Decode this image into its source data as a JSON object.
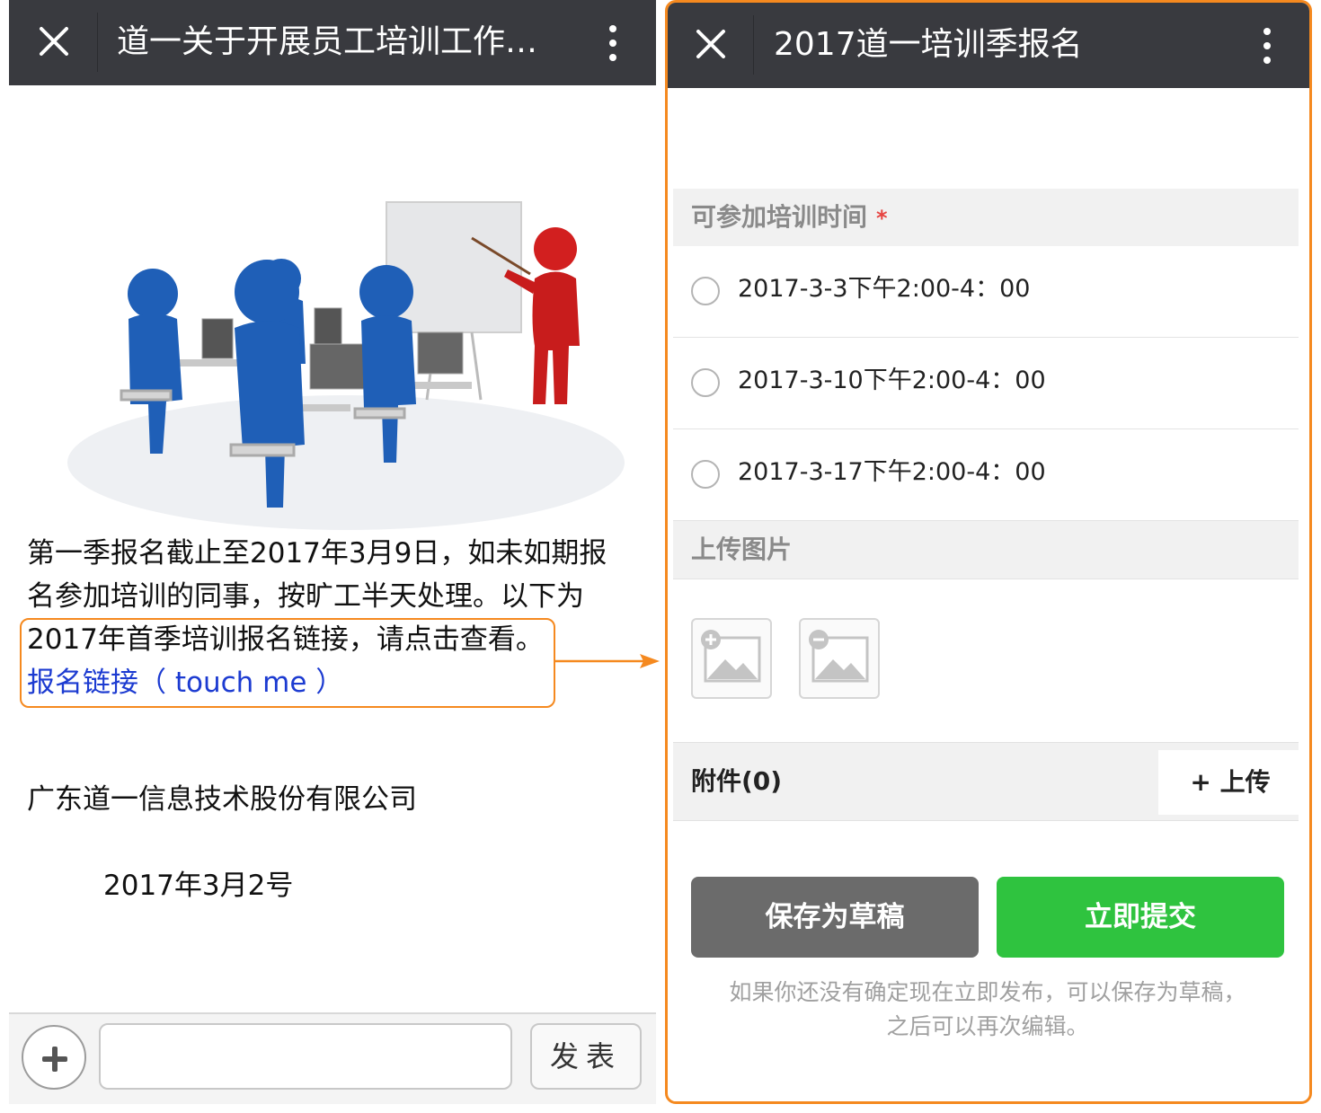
{
  "left_screen": {
    "header": {
      "title": "道一关于开展员工培训工作通...",
      "close_icon": "close-icon",
      "more_icon": "more-vertical-icon"
    },
    "article": {
      "line1": "第一季报名截止至2017年3月9日，如未如期报",
      "line2": "名参加培训的同事，按旷工半天处理。以下为",
      "line3": "2017年首季培训报名链接，请点击查看。",
      "link_text": "报名链接（ touch me ）",
      "company": "广东道一信息技术股份有限公司",
      "date": "2017年3月2号"
    },
    "comment_bar": {
      "plus_icon": "plus-icon",
      "input_value": "",
      "send_label": "发表"
    }
  },
  "right_screen": {
    "header": {
      "title": "2017道一培训季报名",
      "close_icon": "close-icon",
      "more_icon": "more-vertical-icon"
    },
    "training_time": {
      "label": "可参加培训时间",
      "required_mark": "*",
      "options": [
        "2017-3-3下午2:00-4：00",
        "2017-3-10下午2:00-4：00",
        "2017-3-17下午2:00-4：00"
      ]
    },
    "upload_images": {
      "label": "上传图片",
      "add_icon": "add-image-icon",
      "remove_icon": "remove-image-icon"
    },
    "attachment": {
      "label": "附件(0)",
      "upload_label": "+ 上传"
    },
    "buttons": {
      "draft": "保存为草稿",
      "submit": "立即提交"
    },
    "hint_line1": "如果你还没有确定现在立即发布，可以保存为草稿，",
    "hint_line2": "之后可以再次编辑。"
  },
  "colors": {
    "header_bg": "#393a3f",
    "highlight_orange": "#f5891f",
    "link_blue": "#1c3bd1",
    "submit_green": "#2fc33f",
    "draft_gray": "#6b6b6b",
    "required_red": "#e64340"
  }
}
